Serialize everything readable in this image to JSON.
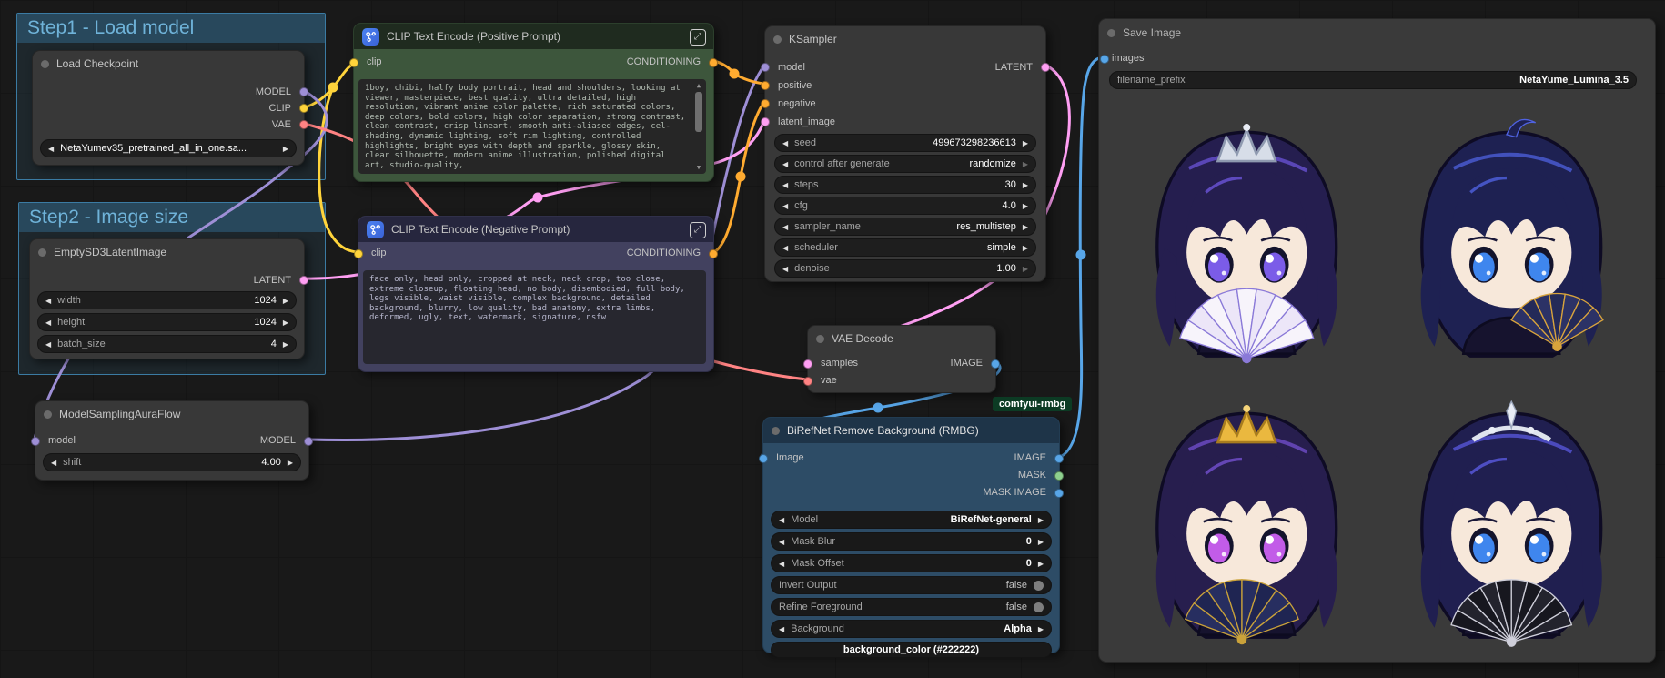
{
  "groups": {
    "step1": "Step1 - Load model",
    "step2": "Step2 - Image size"
  },
  "icons": {
    "left": "◀",
    "right": "▶",
    "up": "▲",
    "down": "▼",
    "expand": "⤢"
  },
  "colors": {
    "model": "#9e8fd6",
    "clip": "#ffd43b",
    "vae": "#ff8383",
    "conditioning": "#ffab30",
    "latent": "#ff9ff3",
    "image": "#58a6e8",
    "mask": "#8ed08e"
  },
  "nodes": {
    "checkpoint": {
      "title": "Load Checkpoint",
      "out": [
        "MODEL",
        "CLIP",
        "VAE"
      ],
      "ckpt": "NetaYumev35_pretrained_all_in_one.sa..."
    },
    "latent": {
      "title": "EmptySD3LatentImage",
      "out": "LATENT",
      "w": [
        {
          "l": "width",
          "v": "1024"
        },
        {
          "l": "height",
          "v": "1024"
        },
        {
          "l": "batch_size",
          "v": "4"
        }
      ]
    },
    "msaf": {
      "title": "ModelSamplingAuraFlow",
      "in": "model",
      "out": "MODEL",
      "w": {
        "l": "shift",
        "v": "4.00"
      }
    },
    "pos": {
      "title": "CLIP Text Encode (Positive Prompt)",
      "in": "clip",
      "out": "CONDITIONING",
      "text": "1boy, chibi, halfy body portrait, head and shoulders, looking at viewer, masterpiece, best quality, ultra detailed, high resolution, vibrant anime color palette, rich saturated colors, deep colors, bold colors, high color separation, strong contrast, clean contrast, crisp lineart, smooth anti-aliased edges, cel-shading, dynamic lighting, soft rim lighting, controlled highlights, bright eyes with depth and sparkle, glossy skin, clear silhouette, modern anime illustration, polished digital art, studio-quality,"
    },
    "neg": {
      "title": "CLIP Text Encode (Negative Prompt)",
      "in": "clip",
      "out": "CONDITIONING",
      "text": "face only, head only, cropped at neck, neck crop, too close, extreme closeup, floating head, no body, disembodied, full body, legs visible, waist visible, complex background, detailed background, blurry, low quality, bad anatomy, extra limbs, deformed, ugly, text, watermark, signature, nsfw"
    },
    "ksampler": {
      "title": "KSampler",
      "in": [
        "model",
        "positive",
        "negative",
        "latent_image"
      ],
      "out": "LATENT",
      "w": [
        {
          "l": "seed",
          "v": "499673298236613"
        },
        {
          "l": "control after generate",
          "v": "randomize"
        },
        {
          "l": "steps",
          "v": "30"
        },
        {
          "l": "cfg",
          "v": "4.0"
        },
        {
          "l": "sampler_name",
          "v": "res_multistep"
        },
        {
          "l": "scheduler",
          "v": "simple"
        },
        {
          "l": "denoise",
          "v": "1.00"
        }
      ]
    },
    "vae": {
      "title": "VAE Decode",
      "in": [
        "samples",
        "vae"
      ],
      "out": "IMAGE"
    },
    "rmbg": {
      "badge": "comfyui-rmbg",
      "title": "BiRefNet Remove Background (RMBG)",
      "in": "Image",
      "out": [
        "IMAGE",
        "MASK",
        "MASK IMAGE"
      ],
      "w": [
        {
          "l": "Model",
          "v": "BiRefNet-general"
        },
        {
          "l": "Mask Blur",
          "v": "0"
        },
        {
          "l": "Mask Offset",
          "v": "0"
        },
        {
          "l": "Invert Output",
          "v": "false"
        },
        {
          "l": "Refine Foreground",
          "v": "false"
        },
        {
          "l": "Background",
          "v": "Alpha"
        }
      ],
      "button": "background_color (#222222)"
    },
    "save": {
      "title": "Save Image",
      "in": "images",
      "w": {
        "l": "filename_prefix",
        "v": "NetaYume_Lumina_3.5"
      }
    }
  }
}
